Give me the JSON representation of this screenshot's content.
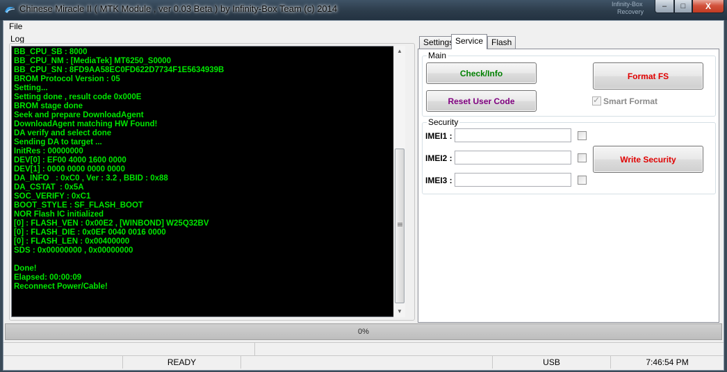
{
  "window": {
    "title": "Chinese Miracle II ( MTK Module , ver 0.03 Beta ) by Infinity-Box Team (c) 2014",
    "background_text": [
      "Infinity-Box",
      "Recovery"
    ],
    "minimize_glyph": "–",
    "maximize_glyph": "□",
    "close_glyph": "X"
  },
  "menu": {
    "file": "File"
  },
  "log": {
    "label": "Log",
    "lines": [
      "BB_CPU_SB : 8000",
      "BB_CPU_NM : [MediaTek] MT6250_S0000",
      "BB_CPU_SN : 8FD9AA58EC0FD622D7734F1E5634939B",
      "BROM Protocol Version : 05",
      "Setting...",
      "Setting done , result code 0x000E",
      "BROM stage done",
      "Seek and prepare DownloadAgent",
      "DownloadAgent matching HW Found!",
      "DA verify and select done",
      "Sending DA to target ...",
      "InitRes : 00000000",
      "DEV[0] : EF00 4000 1600 0000",
      "DEV[1] : 0000 0000 0000 0000",
      "DA_INFO   : 0xC0 , Ver : 3.2 , BBID : 0x88",
      "DA_CSTAT  : 0x5A",
      "SOC_VERIFY : 0xC1",
      "BOOT_STYLE : SF_FLASH_BOOT",
      "NOR Flash IC initialized",
      "[0] : FLASH_VEN : 0x00E2 , [WINBOND] W25Q32BV",
      "[0] : FLASH_DIE : 0x0EF 0040 0016 0000",
      "[0] : FLASH_LEN : 0x00400000",
      "SDS : 0x00000000 , 0x00000000",
      "",
      "Done!",
      "Elapsed: 00:00:09",
      "Reconnect Power/Cable!"
    ]
  },
  "tabs": [
    {
      "label": "Settings"
    },
    {
      "label": "Service"
    },
    {
      "label": "Flash"
    }
  ],
  "service": {
    "main": {
      "title": "Main",
      "check_info": "Check/Info",
      "format_fs": "Format FS",
      "reset_user_code": "Reset User Code",
      "smart_format": "Smart Format"
    },
    "security": {
      "title": "Security",
      "imei1_label": "IMEI1 :",
      "imei2_label": "IMEI2 :",
      "imei3_label": "IMEI3 :",
      "imei1_value": "",
      "imei2_value": "",
      "imei3_value": "",
      "write_security": "Write Security"
    }
  },
  "progress": {
    "text": "0%",
    "value": 0
  },
  "status": {
    "state": "READY",
    "connection": "USB",
    "time": "7:46:54 PM"
  },
  "colors": {
    "log_text": "#00e600",
    "check_info": "#008000",
    "format_fs": "#e00000",
    "reset_user_code": "#800080",
    "write_security": "#e00000"
  }
}
